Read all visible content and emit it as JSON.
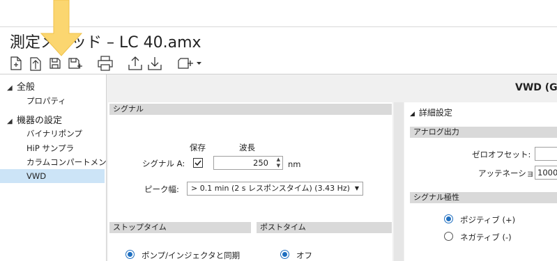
{
  "window": {
    "title": "測定メソッド – LC 40.amx"
  },
  "colors": {
    "highlight_arrow": "#fbd670",
    "selection": "#cce4f7",
    "section_bar": "#d9d9d9",
    "radio_accent": "#1f6fc0"
  },
  "toolbar": {
    "icons": [
      "new-icon",
      "open-icon",
      "save-icon",
      "save-as-icon",
      "print-icon",
      "upload-icon",
      "download-icon",
      "add-dropdown-icon"
    ]
  },
  "sidebar": {
    "groups": [
      {
        "label": "全般",
        "items": [
          {
            "label": "プロパティ"
          }
        ]
      },
      {
        "label": "機器の設定",
        "items": [
          {
            "label": "バイナリポンプ"
          },
          {
            "label": "HiP サンプラ"
          },
          {
            "label": "カラムコンパートメント"
          },
          {
            "label": "VWD",
            "selected": true
          }
        ]
      }
    ]
  },
  "main": {
    "header": "VWD (G",
    "signal": {
      "section": "シグナル",
      "col_save": "保存",
      "col_wavelength": "波長",
      "row_label": "シグナル A:",
      "save_checked": true,
      "wavelength": "250",
      "unit": "nm",
      "peak_width_label": "ピーク幅:",
      "peak_width_value": "> 0.1 min (2 s レスポンスタイム) (3.43 Hz)"
    },
    "stoptime": {
      "section": "ストップタイム",
      "option": "ポンプ/インジェクタと同期",
      "selected": true
    },
    "posttime": {
      "section": "ポストタイム",
      "option": "オフ",
      "selected": true
    }
  },
  "details": {
    "title": "詳細設定",
    "analog": {
      "section": "アナログ出力",
      "zero_offset_label": "ゼロオフセット:",
      "zero_offset_value": "",
      "attenuation_label": "アッテネーション:",
      "attenuation_value": "1000"
    },
    "polarity": {
      "section": "シグナル極性",
      "positive": "ポジティブ (+)",
      "negative": "ネガティブ (-)",
      "selected": "positive"
    }
  }
}
